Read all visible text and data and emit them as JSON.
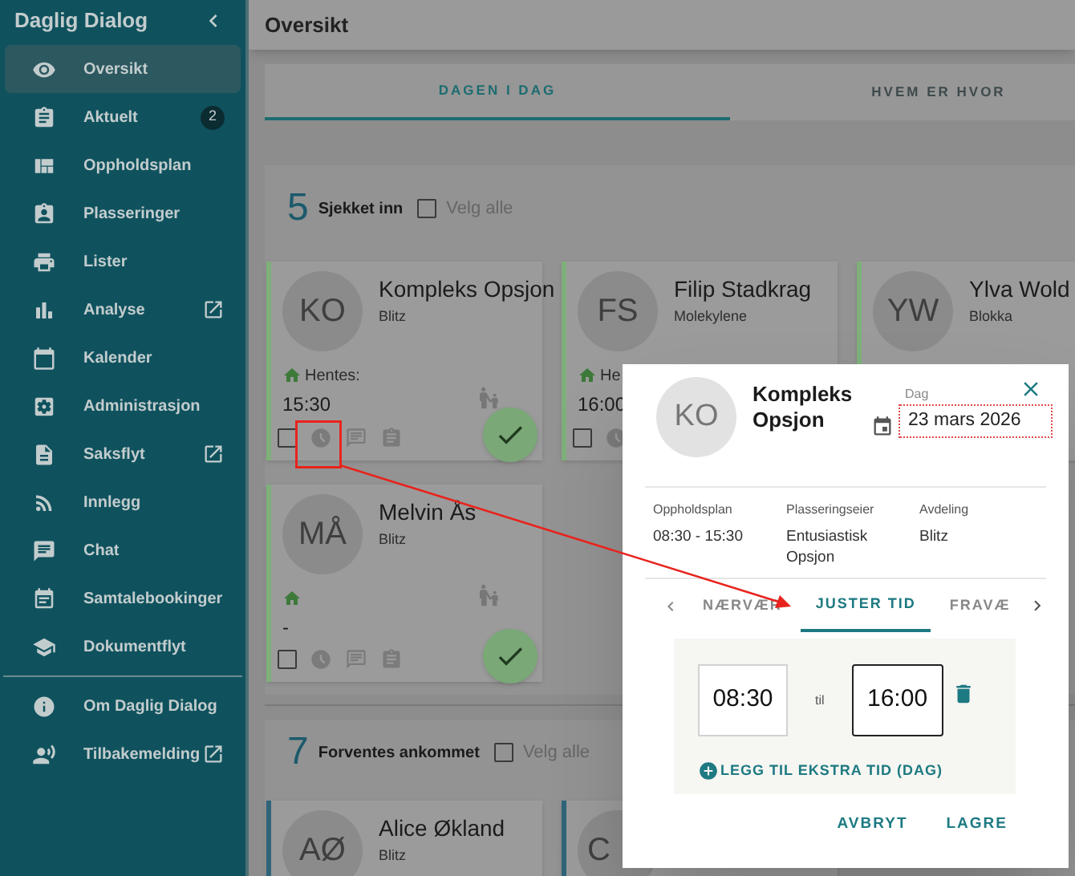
{
  "sidebar": {
    "title": "Daglig Dialog",
    "items": [
      {
        "label": "Oversikt",
        "selected": true,
        "external": false
      },
      {
        "label": "Aktuelt",
        "selected": false,
        "external": false,
        "badge": "2"
      },
      {
        "label": "Oppholdsplan",
        "selected": false,
        "external": false
      },
      {
        "label": "Plasseringer",
        "selected": false,
        "external": false
      },
      {
        "label": "Lister",
        "selected": false,
        "external": false
      },
      {
        "label": "Analyse",
        "selected": false,
        "external": true
      },
      {
        "label": "Kalender",
        "selected": false,
        "external": false
      },
      {
        "label": "Administrasjon",
        "selected": false,
        "external": false
      },
      {
        "label": "Saksflyt",
        "selected": false,
        "external": true
      },
      {
        "label": "Innlegg",
        "selected": false,
        "external": false
      },
      {
        "label": "Chat",
        "selected": false,
        "external": false
      },
      {
        "label": "Samtalebookinger",
        "selected": false,
        "external": false
      },
      {
        "label": "Dokumentflyt",
        "selected": false,
        "external": false
      }
    ],
    "footer_items": [
      {
        "label": "Om Daglig Dialog",
        "selected": false,
        "external": false
      },
      {
        "label": "Tilbakemelding",
        "selected": false,
        "external": true
      }
    ]
  },
  "header": {
    "title": "Oversikt"
  },
  "tabs": [
    {
      "label": "DAGEN I DAG",
      "selected": true
    },
    {
      "label": "HVEM ER HVOR",
      "selected": false
    }
  ],
  "sections": [
    {
      "count": "5",
      "label": "Sjekket inn",
      "select_all": {
        "label": "Velg alle",
        "checked": false
      },
      "cards": [
        {
          "initials": "KO",
          "name": "Kompleks Opsjon",
          "group": "Blitz",
          "color": "#7fb07a",
          "pickup_label": "Hentes:",
          "pickup_time": "15:30",
          "checked": false,
          "checked_in": true
        },
        {
          "initials": "FS",
          "name": "Filip Stadkrag",
          "group": "Molekylene",
          "color": "#7fb07a",
          "pickup_label": "He",
          "pickup_time": "16:00",
          "checked": false
        },
        {
          "initials": "YW",
          "name": "Ylva Wold",
          "group": "Blokka",
          "color": "#7fb07a"
        },
        {
          "initials": "MÅ",
          "name": "Melvin Ås",
          "group": "Blitz",
          "color": "#7fb07a",
          "pickup_time": "-",
          "checked": false,
          "checked_in": true
        }
      ]
    },
    {
      "count": "7",
      "label": "Forventes ankommet",
      "select_all": {
        "label": "Velg alle",
        "checked": false
      },
      "cards": [
        {
          "initials": "AØ",
          "name": "Alice Økland",
          "group": "Blitz",
          "color": "#2f6479"
        },
        {
          "initials": "C",
          "color": "#2f6479"
        }
      ]
    }
  ],
  "dialog": {
    "initials": "KO",
    "name": "Kompleks Opsjon",
    "date_label": "Dag",
    "date": "23 mars 2026",
    "info": [
      {
        "label": "Oppholdsplan",
        "value": "08:30 - 15:30"
      },
      {
        "label": "Plasseringseier",
        "value": "Entusiastisk Opsjon"
      },
      {
        "label": "Avdeling",
        "value": "Blitz"
      }
    ],
    "tabs": [
      {
        "label": "NÆRVÆR",
        "selected": false
      },
      {
        "label": "JUSTER TID",
        "selected": true
      },
      {
        "label": "FRAVÆ",
        "selected": false
      }
    ],
    "from": "08:30",
    "separator": "til",
    "to": "16:00",
    "add_label": "LEGG TIL EKSTRA TID (DAG)",
    "buttons": [
      "AVBRYT",
      "LAGRE"
    ]
  }
}
